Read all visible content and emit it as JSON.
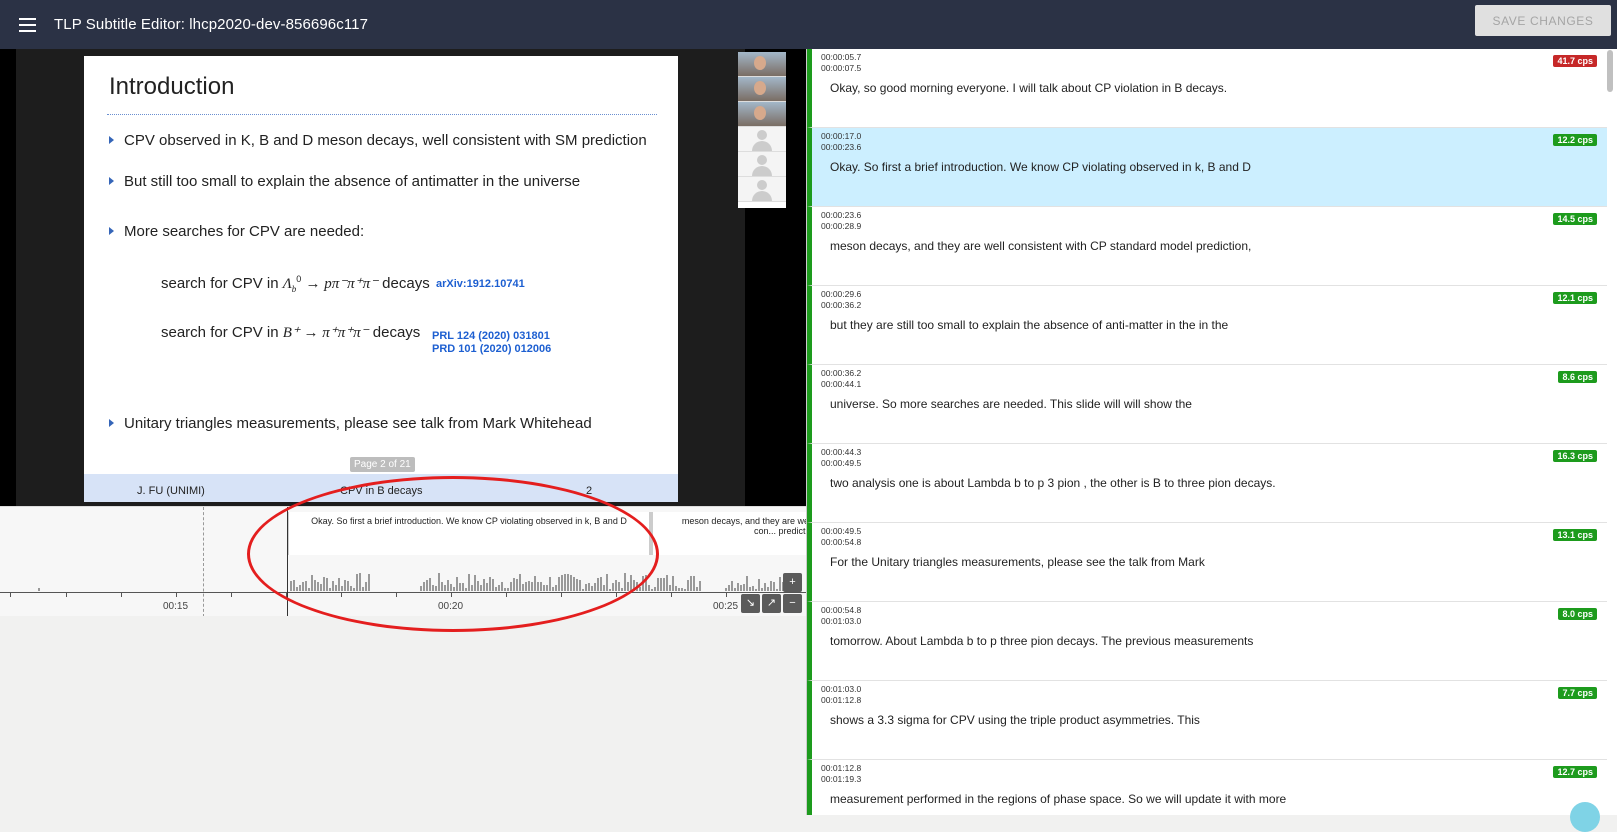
{
  "app": {
    "title": "TLP Subtitle Editor: lhcp2020-dev-856696c117",
    "save_label": "SAVE CHANGES"
  },
  "slide": {
    "title": "Introduction",
    "bullets": [
      "CPV observed in K, B and D meson decays, well consistent with SM prediction",
      "But still too small to explain the absence of antimatter in the universe",
      "More searches for CPV are needed:",
      "Unitary triangles measurements, please see talk from Mark Whitehead"
    ],
    "formula1_prefix": "search for CPV in ",
    "formula1_math": "Λ",
    "formula1_rest": "→ pπ⁻π⁺π⁻",
    "formula1_suffix": " decays",
    "formula2_prefix": "search for CPV in ",
    "formula2_math": "B⁺ → π⁺π⁺π⁻",
    "formula2_suffix": " decays",
    "ref1": "arXiv:1912.10741",
    "ref2a": "PRL 124 (2020) 031801",
    "ref2b": "PRD 101 (2020) 012006",
    "page_badge": "Page 2 of 21",
    "footer_author": "J. FU (UNIMI)",
    "footer_title": "CPV in B decays",
    "footer_page": "2"
  },
  "timeline": {
    "cue1": "Okay. So first a brief introduction. We know CP violating observed in k, B and D",
    "cue2": "meson decays, and they are well con... predict...",
    "ticks": [
      "00:15",
      "00:20",
      "00:25"
    ]
  },
  "subtitles": [
    {
      "start": "00:00:05.7",
      "end": "00:00:07.5",
      "cps": "41.7 cps",
      "level": "high",
      "text": "Okay, so good morning everyone. I will talk about CP violation in B decays."
    },
    {
      "start": "00:00:17.0",
      "end": "00:00:23.6",
      "cps": "12.2 cps",
      "level": "ok",
      "text": "Okay. So first a brief introduction. We know CP violating observed in k, B and D"
    },
    {
      "start": "00:00:23.6",
      "end": "00:00:28.9",
      "cps": "14.5 cps",
      "level": "ok",
      "text": "meson decays, and they are well consistent with CP standard model prediction,"
    },
    {
      "start": "00:00:29.6",
      "end": "00:00:36.2",
      "cps": "12.1 cps",
      "level": "ok",
      "text": "but they are still too small to explain the absence of anti-matter in the in the"
    },
    {
      "start": "00:00:36.2",
      "end": "00:00:44.1",
      "cps": "8.6 cps",
      "level": "ok",
      "text": "universe. So more searches are needed. This slide will will show the"
    },
    {
      "start": "00:00:44.3",
      "end": "00:00:49.5",
      "cps": "16.3 cps",
      "level": "ok",
      "text": "two analysis one is about Lambda b to p 3 pion , the other is B to three pion decays."
    },
    {
      "start": "00:00:49.5",
      "end": "00:00:54.8",
      "cps": "13.1 cps",
      "level": "ok",
      "text": "For the Unitary triangles measurements, please see the talk from Mark"
    },
    {
      "start": "00:00:54.8",
      "end": "00:01:03.0",
      "cps": "8.0 cps",
      "level": "ok",
      "text": "tomorrow. About Lambda b to p three pion decays. The previous measurements"
    },
    {
      "start": "00:01:03.0",
      "end": "00:01:12.8",
      "cps": "7.7 cps",
      "level": "ok",
      "text": "shows a 3.3 sigma for CPV using the triple product asymmetries. This"
    },
    {
      "start": "00:01:12.8",
      "end": "00:01:19.3",
      "cps": "12.7 cps",
      "level": "ok",
      "text": "measurement performed in the regions of phase space. So we will update it with more"
    }
  ],
  "colors": {
    "cps_high": "#c62828",
    "cps_ok": "#1d9b1d",
    "active": "#ccefff",
    "topbar": "#2b3245"
  }
}
